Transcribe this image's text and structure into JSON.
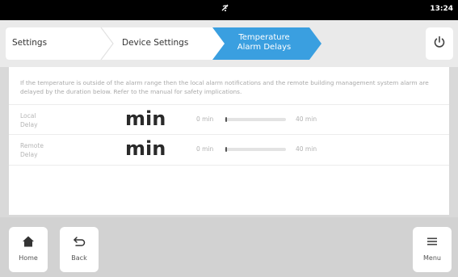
{
  "status": {
    "time": "13:24",
    "center_icon": "no-signal-icon"
  },
  "breadcrumb": {
    "items": [
      {
        "label": "Settings"
      },
      {
        "label": "Device Settings"
      },
      {
        "label_line1": "Temperature",
        "label_line2": "Alarm Delays"
      }
    ],
    "active_color": "#3a9fe0",
    "power_icon": "power-icon"
  },
  "main": {
    "info": "If the temperature is outside of the alarm range then the local alarm notifications and the remote building management system alarm are delayed by the duration below. Refer to the manual for safety implications.",
    "rows": [
      {
        "label_line1": "Local",
        "label_line2": "Delay",
        "value": "min",
        "slider_min": "0 min",
        "slider_max": "40 min",
        "level": 0
      },
      {
        "label_line1": "Remote",
        "label_line2": "Delay",
        "value": "min",
        "slider_min": "0 min",
        "slider_max": "40 min",
        "level": 0
      }
    ]
  },
  "bottom": {
    "home_label": "Home",
    "back_label": "Back",
    "menu_label": "Menu"
  }
}
